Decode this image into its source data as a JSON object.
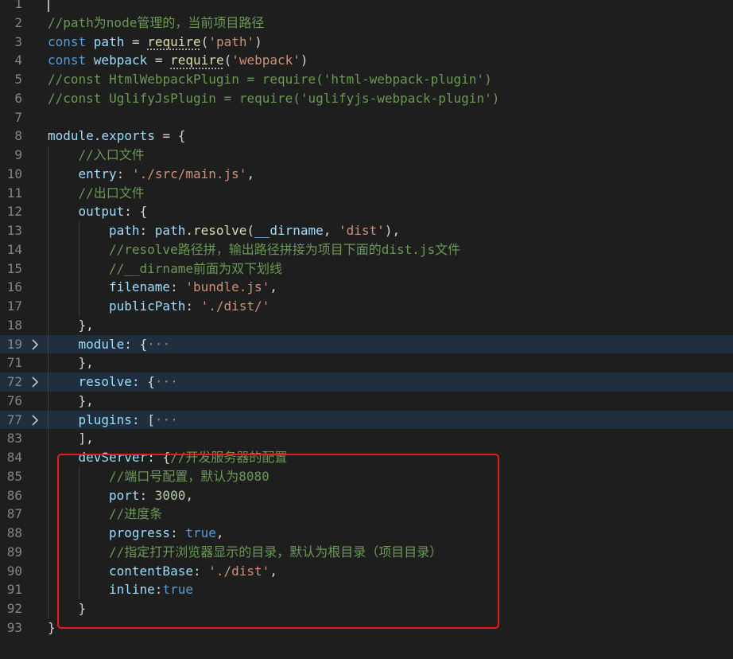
{
  "editor": {
    "lines": [
      {
        "n": "1",
        "t": [
          {
            "c": "pn",
            "v": ""
          }
        ]
      },
      {
        "n": "2",
        "t": [
          {
            "c": "cm",
            "v": "//path为node管理的，当前项目路径"
          }
        ]
      },
      {
        "n": "3",
        "t": [
          {
            "c": "kw",
            "v": "const "
          },
          {
            "c": "var",
            "v": "path"
          },
          {
            "c": "pn",
            "v": " = "
          },
          {
            "c": "fn",
            "v": "require"
          },
          {
            "c": "pn",
            "v": "("
          },
          {
            "c": "str",
            "v": "'path'"
          },
          {
            "c": "pn",
            "v": ")"
          }
        ]
      },
      {
        "n": "4",
        "t": [
          {
            "c": "kw",
            "v": "const "
          },
          {
            "c": "var",
            "v": "webpack"
          },
          {
            "c": "pn",
            "v": " = "
          },
          {
            "c": "fn",
            "v": "require"
          },
          {
            "c": "pn",
            "v": "("
          },
          {
            "c": "str",
            "v": "'webpack'"
          },
          {
            "c": "pn",
            "v": ")"
          }
        ]
      },
      {
        "n": "5",
        "t": [
          {
            "c": "cm",
            "v": "//const HtmlWebpackPlugin = require('html-webpack-plugin')"
          }
        ]
      },
      {
        "n": "6",
        "t": [
          {
            "c": "cm",
            "v": "//const UglifyJsPlugin = require('uglifyjs-webpack-plugin')"
          }
        ]
      },
      {
        "n": "7",
        "t": [
          {
            "c": "pn",
            "v": ""
          }
        ]
      },
      {
        "n": "8",
        "t": [
          {
            "c": "var",
            "v": "module"
          },
          {
            "c": "pn",
            "v": "."
          },
          {
            "c": "var",
            "v": "exports"
          },
          {
            "c": "pn",
            "v": " = {"
          }
        ]
      },
      {
        "n": "9",
        "indent": 1,
        "t": [
          {
            "c": "cm",
            "v": "//入口文件"
          }
        ]
      },
      {
        "n": "10",
        "indent": 1,
        "t": [
          {
            "c": "var",
            "v": "entry"
          },
          {
            "c": "pn",
            "v": ": "
          },
          {
            "c": "str",
            "v": "'./src/main.js'"
          },
          {
            "c": "pn",
            "v": ","
          }
        ]
      },
      {
        "n": "11",
        "indent": 1,
        "t": [
          {
            "c": "cm",
            "v": "//出口文件"
          }
        ]
      },
      {
        "n": "12",
        "indent": 1,
        "t": [
          {
            "c": "var",
            "v": "output"
          },
          {
            "c": "pn",
            "v": ": {"
          }
        ]
      },
      {
        "n": "13",
        "indent": 2,
        "t": [
          {
            "c": "var",
            "v": "path"
          },
          {
            "c": "pn",
            "v": ": "
          },
          {
            "c": "var",
            "v": "path"
          },
          {
            "c": "pn",
            "v": "."
          },
          {
            "c": "fn",
            "v": "resolve"
          },
          {
            "c": "pn",
            "v": "("
          },
          {
            "c": "var",
            "v": "__dirname"
          },
          {
            "c": "pn",
            "v": ", "
          },
          {
            "c": "str",
            "v": "'dist'"
          },
          {
            "c": "pn",
            "v": "),"
          }
        ]
      },
      {
        "n": "14",
        "indent": 2,
        "t": [
          {
            "c": "cm",
            "v": "//resolve路径拼，输出路径拼接为项目下面的dist.js文件"
          }
        ]
      },
      {
        "n": "15",
        "indent": 2,
        "t": [
          {
            "c": "cm",
            "v": "//__dirname前面为双下划线"
          }
        ]
      },
      {
        "n": "16",
        "indent": 2,
        "t": [
          {
            "c": "var",
            "v": "filename"
          },
          {
            "c": "pn",
            "v": ": "
          },
          {
            "c": "str",
            "v": "'bundle.js'"
          },
          {
            "c": "pn",
            "v": ","
          }
        ]
      },
      {
        "n": "17",
        "indent": 2,
        "t": [
          {
            "c": "var",
            "v": "publicPath"
          },
          {
            "c": "pn",
            "v": ": "
          },
          {
            "c": "str",
            "v": "'./dist/'"
          }
        ]
      },
      {
        "n": "18",
        "indent": 1,
        "t": [
          {
            "c": "pn",
            "v": "},"
          }
        ]
      },
      {
        "n": "19",
        "indent": 1,
        "folded": true,
        "t": [
          {
            "c": "var",
            "v": "module"
          },
          {
            "c": "pn",
            "v": ": {"
          },
          {
            "c": "ell",
            "v": "···"
          }
        ]
      },
      {
        "n": "71",
        "indent": 1,
        "t": [
          {
            "c": "pn",
            "v": "},"
          }
        ]
      },
      {
        "n": "72",
        "indent": 1,
        "folded": true,
        "t": [
          {
            "c": "var",
            "v": "resolve"
          },
          {
            "c": "pn",
            "v": ": {"
          },
          {
            "c": "ell",
            "v": "···"
          }
        ]
      },
      {
        "n": "76",
        "indent": 1,
        "t": [
          {
            "c": "pn",
            "v": "},"
          }
        ]
      },
      {
        "n": "77",
        "indent": 1,
        "folded": true,
        "t": [
          {
            "c": "var",
            "v": "plugins"
          },
          {
            "c": "pn",
            "v": ": ["
          },
          {
            "c": "ell",
            "v": "···"
          }
        ]
      },
      {
        "n": "83",
        "indent": 1,
        "t": [
          {
            "c": "pn",
            "v": "],"
          }
        ]
      },
      {
        "n": "84",
        "indent": 1,
        "t": [
          {
            "c": "var",
            "v": "devServer"
          },
          {
            "c": "pn",
            "v": ": {"
          },
          {
            "c": "cm",
            "v": "//开发服务器的配置"
          }
        ]
      },
      {
        "n": "85",
        "indent": 2,
        "t": [
          {
            "c": "cm",
            "v": "//端口号配置，默认为8080"
          }
        ]
      },
      {
        "n": "86",
        "indent": 2,
        "t": [
          {
            "c": "var",
            "v": "port"
          },
          {
            "c": "pn",
            "v": ": "
          },
          {
            "c": "num",
            "v": "3000"
          },
          {
            "c": "pn",
            "v": ","
          }
        ]
      },
      {
        "n": "87",
        "indent": 2,
        "t": [
          {
            "c": "cm",
            "v": "//进度条"
          }
        ]
      },
      {
        "n": "88",
        "indent": 2,
        "t": [
          {
            "c": "var",
            "v": "progress"
          },
          {
            "c": "pn",
            "v": ": "
          },
          {
            "c": "kw",
            "v": "true"
          },
          {
            "c": "pn",
            "v": ","
          }
        ]
      },
      {
        "n": "89",
        "indent": 2,
        "t": [
          {
            "c": "cm",
            "v": "//指定打开浏览器显示的目录，默认为根目录（项目目录）"
          }
        ]
      },
      {
        "n": "90",
        "indent": 2,
        "t": [
          {
            "c": "var",
            "v": "contentBase"
          },
          {
            "c": "pn",
            "v": ": "
          },
          {
            "c": "str",
            "v": "'./dist'"
          },
          {
            "c": "pn",
            "v": ","
          }
        ]
      },
      {
        "n": "91",
        "indent": 2,
        "t": [
          {
            "c": "var",
            "v": "inline"
          },
          {
            "c": "pn",
            "v": ":"
          },
          {
            "c": "kw",
            "v": "true"
          }
        ]
      },
      {
        "n": "92",
        "indent": 1,
        "t": [
          {
            "c": "pn",
            "v": "}"
          }
        ]
      },
      {
        "n": "93",
        "t": [
          {
            "c": "pn",
            "v": "}"
          }
        ]
      }
    ]
  },
  "colors": {
    "background": "#1e1e1e",
    "folded_line": "#1f2f3d",
    "highlight_box": "#e81c1c"
  }
}
